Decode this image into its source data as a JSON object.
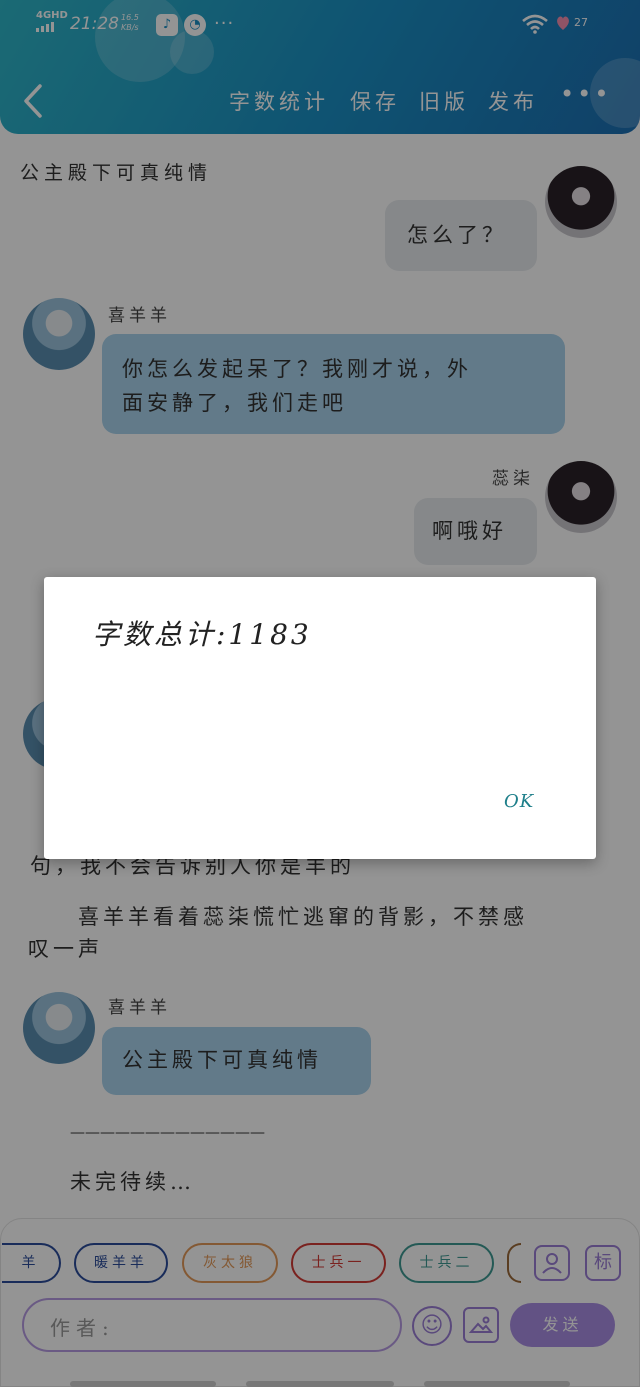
{
  "status_bar": {
    "network": "4GHD",
    "time": "21:28",
    "speed_value": "16.5",
    "speed_unit": "KB/s",
    "battery": "27",
    "more": "···"
  },
  "nav": {
    "back_icon": "chevron-left-icon",
    "word_count": "字数统计",
    "save": "保存",
    "old_version": "旧版",
    "publish": "发布",
    "more": "•••"
  },
  "story_title": "公主殿下可真纯情",
  "messages": [
    {
      "speaker": "",
      "text": "怎么了？",
      "side": "right"
    },
    {
      "speaker": "喜羊羊",
      "text_line1": "你怎么发起呆了？我刚才说，外",
      "text_line2": "面安静了，我们走吧",
      "side": "left"
    },
    {
      "speaker": "蕊柒",
      "text": "啊哦好",
      "side": "right"
    }
  ],
  "narration": {
    "partial_line": "句，我不会告诉别人你是羊的",
    "para_line1": "　　喜羊羊看着蕊柒慌忙逃窜的背影，不禁感",
    "para_line2": "叹一声"
  },
  "last_message": {
    "speaker": "喜羊羊",
    "text": "公主殿下可真纯情"
  },
  "divider": "—————————————",
  "to_be_continued": "未完待续…",
  "characters": [
    {
      "label": "羊",
      "color": "#2b4c9b"
    },
    {
      "label": "暖羊羊",
      "color": "#2b4c9b"
    },
    {
      "label": "灰太狼",
      "color": "#e39a5a"
    },
    {
      "label": "士兵一",
      "color": "#d23b36"
    },
    {
      "label": "士兵二",
      "color": "#3f9a93"
    }
  ],
  "tool_icons": {
    "person": "person-icon",
    "mark": "标"
  },
  "author_placeholder": "作者:",
  "send_label": "发送",
  "dialog": {
    "text": "字数总计:1183",
    "ok": "OK"
  }
}
